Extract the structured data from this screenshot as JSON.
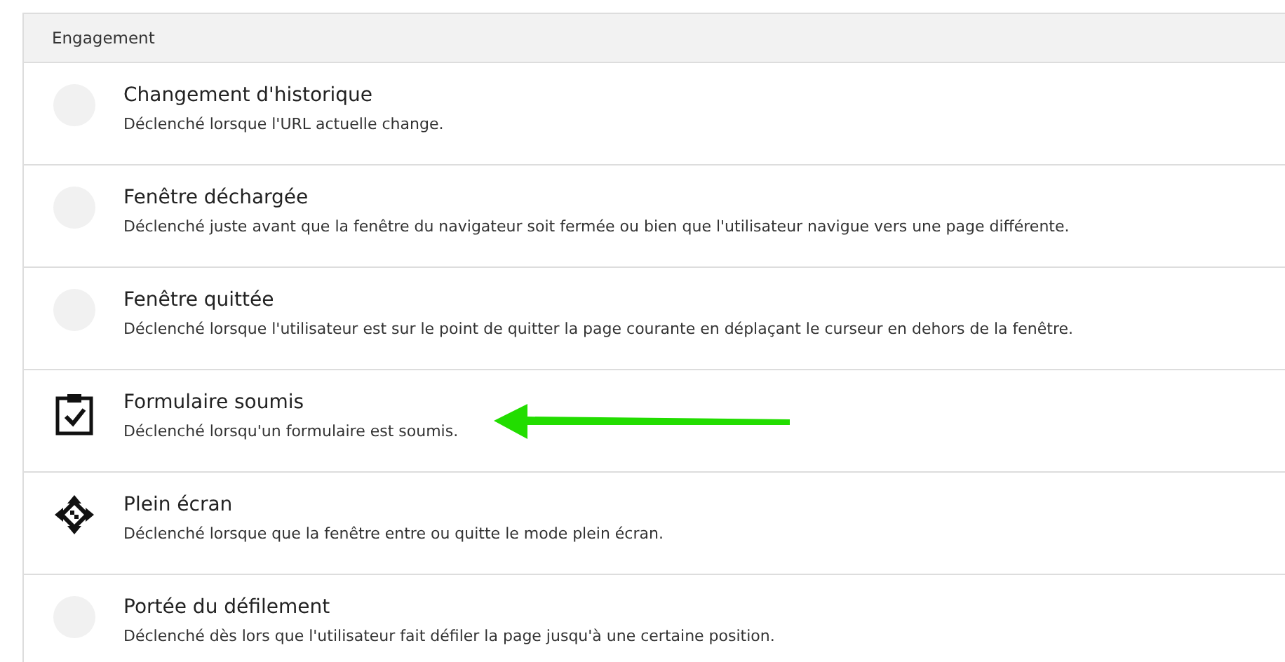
{
  "section": {
    "title": "Engagement"
  },
  "triggers": [
    {
      "kind": "blank",
      "title": "Changement d'historique",
      "description": "Déclenché lorsque l'URL actuelle change."
    },
    {
      "kind": "blank",
      "title": "Fenêtre déchargée",
      "description": "Déclenché juste avant que la fenêtre du navigateur soit fermée ou bien que l'utilisateur navigue vers une page différente."
    },
    {
      "kind": "blank",
      "title": "Fenêtre quittée",
      "description": "Déclenché lorsque l'utilisateur est sur le point de quitter la page courante en déplaçant le curseur en dehors de la fenêtre."
    },
    {
      "kind": "form",
      "title": "Formulaire soumis",
      "description": "Déclenché lorsqu'un formulaire est soumis."
    },
    {
      "kind": "fullscreen",
      "title": "Plein écran",
      "description": "Déclenché lorsque que la fenêtre entre ou quitte le mode plein écran."
    },
    {
      "kind": "blank",
      "title": "Portée du défilement",
      "description": "Déclenché dès lors que l'utilisateur fait défiler la page jusqu'à une certaine position."
    }
  ]
}
